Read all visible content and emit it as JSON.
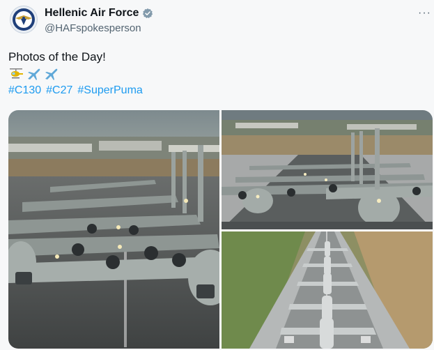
{
  "account": {
    "display_name": "Hellenic Air Force",
    "handle": "@HAFspokesperson",
    "verified": true,
    "avatar_icon": "haf-emblem-icon"
  },
  "menu": {
    "more_label": "···"
  },
  "tweet": {
    "text": "Photos of the Day!",
    "emojis": [
      "helicopter-icon",
      "airplane-icon",
      "airplane-icon"
    ],
    "hashtags": [
      "#C130",
      "#C27",
      "#SuperPuma"
    ]
  },
  "media": {
    "photos": [
      {
        "name": "photo-c130-elephant-walk-closeup"
      },
      {
        "name": "photo-elephant-walk-runway-front"
      },
      {
        "name": "photo-elephant-walk-aerial"
      }
    ]
  },
  "colors": {
    "link": "#1d9bf0",
    "verified_badge": "#829aab",
    "secondary_text": "#536471"
  }
}
